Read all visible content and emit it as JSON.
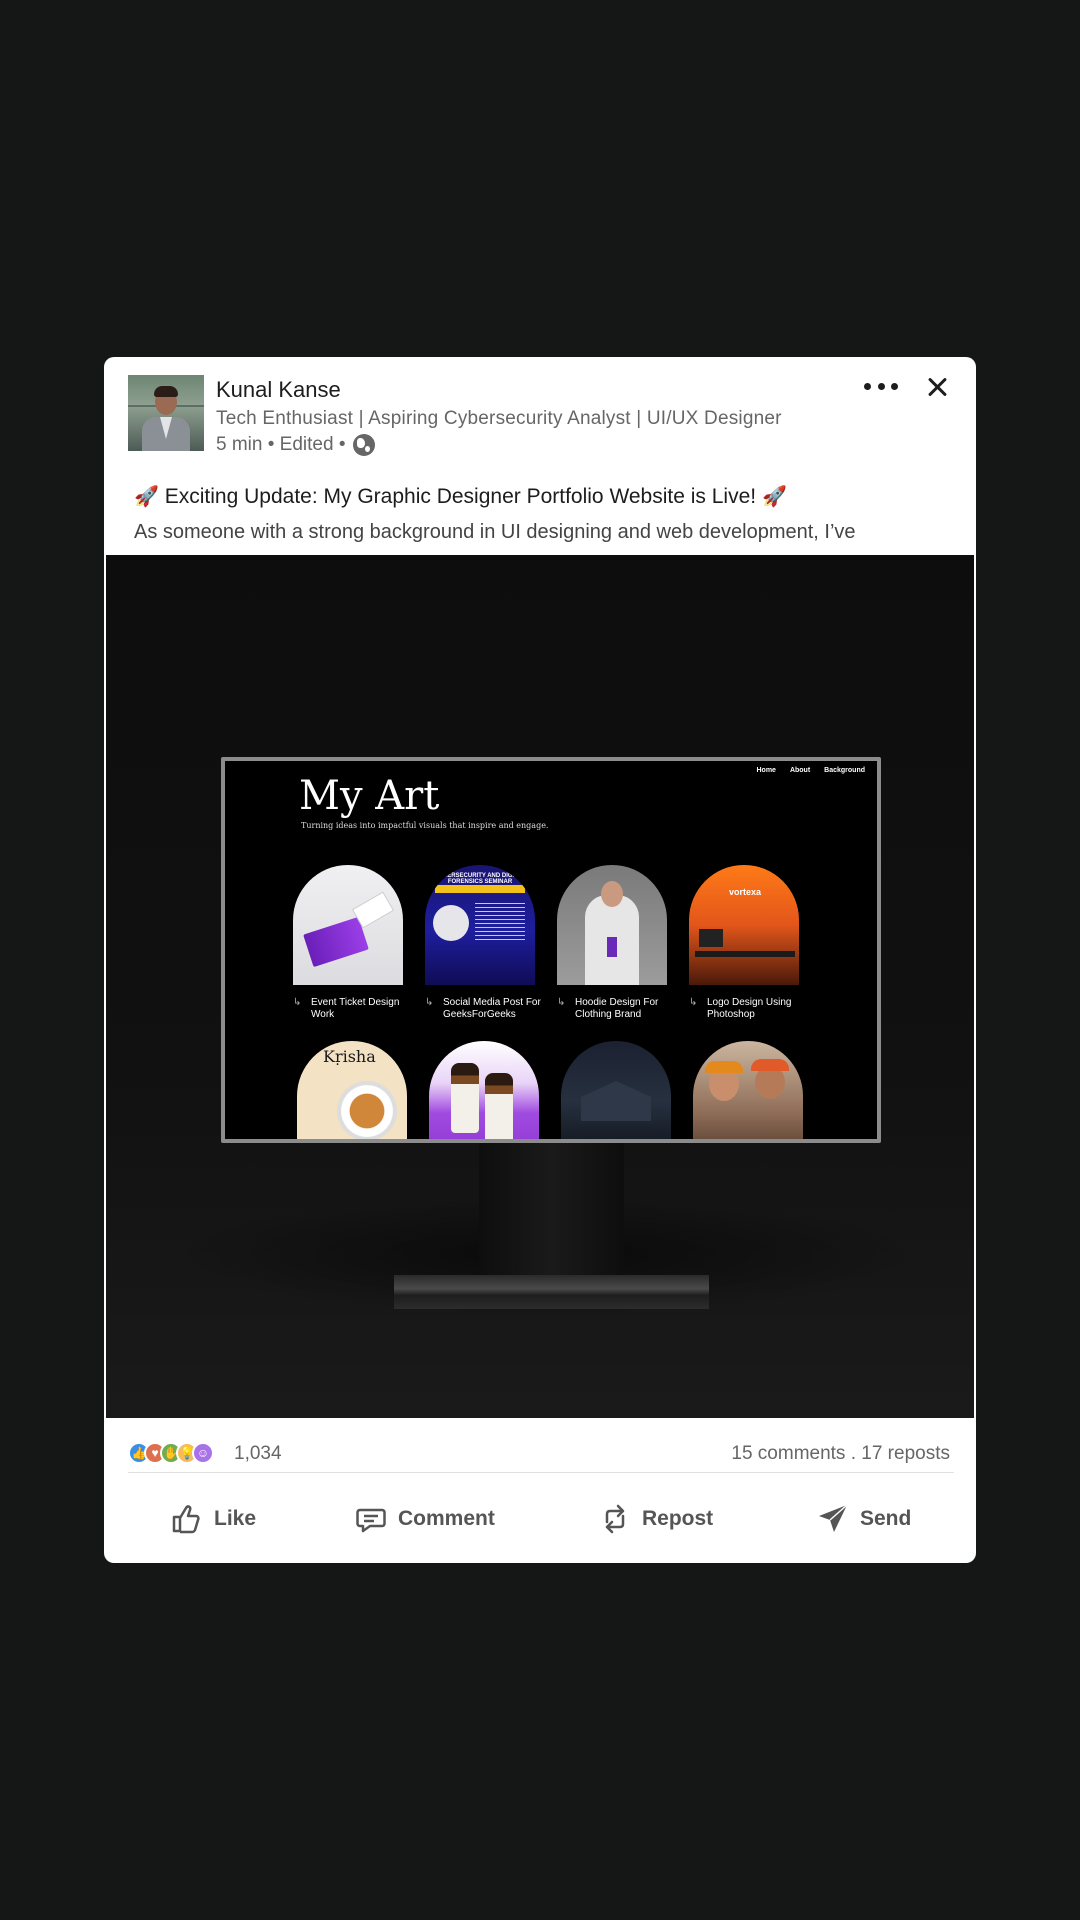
{
  "post": {
    "author": {
      "name": "Kunal Kanse",
      "headline": "Tech Enthusiast | Aspiring Cybersecurity Analyst | UI/UX Designer",
      "meta": "5 min • Edited •"
    },
    "title": "Exciting Update: My Graphic Designer Portfolio Website is Live!",
    "body": "As someone with a strong background in UI designing and web development, I’ve"
  },
  "media": {
    "site": {
      "nav": [
        "Home",
        "About",
        "Background"
      ],
      "heading": "My Art",
      "subheading": "Turning ideas into impactful visuals that inspire and engage.",
      "tiles": [
        {
          "caption": "Event Ticket Design Work"
        },
        {
          "caption": "Social Media Post For GeeksForGeeks"
        },
        {
          "caption": "Hoodie Design For Clothing Brand"
        },
        {
          "caption": "Logo Design Using Photoshop"
        }
      ],
      "tile_texts": {
        "seminar": "CYBERSECURITY AND DIGITAL FORENSICS SEMINAR",
        "brand": "vortexa",
        "restaurant": "Kṛisha"
      }
    }
  },
  "stats": {
    "reaction_count": "1,034",
    "comments_reposts": "15 comments . 17 reposts"
  },
  "actions": {
    "like": "Like",
    "comment": "Comment",
    "repost": "Repost",
    "send": "Send"
  },
  "icons": {
    "more": "more-icon",
    "close": "close-icon",
    "globe": "globe-icon",
    "rocket": "rocket-icon",
    "like": "thumbs-up-icon",
    "comment": "comment-icon",
    "repost": "repost-icon",
    "send": "send-icon"
  }
}
